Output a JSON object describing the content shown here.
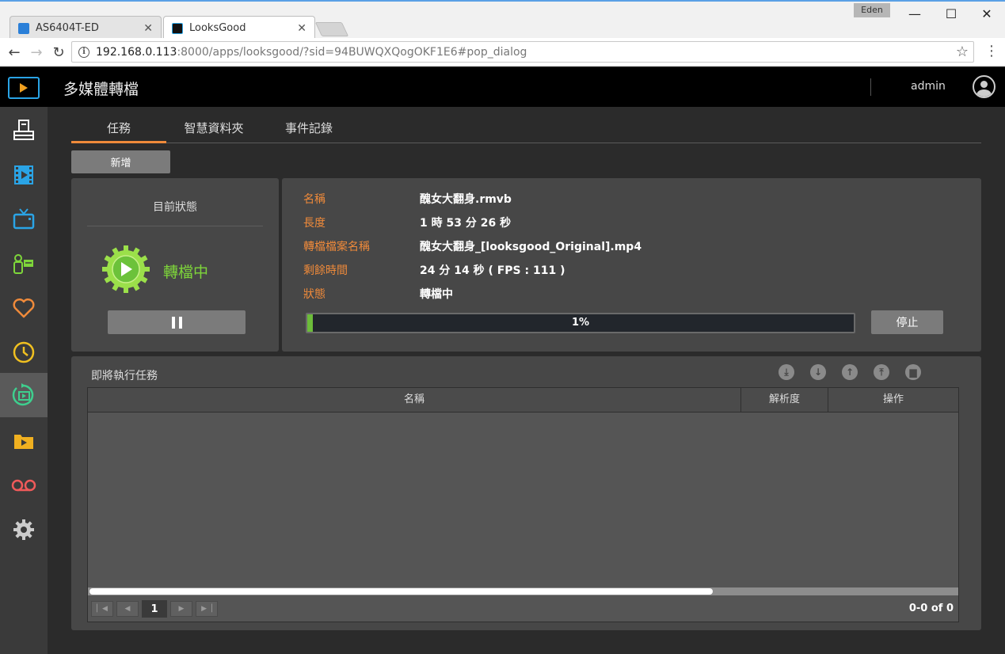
{
  "browser": {
    "tabs": [
      {
        "title": "AS6404T-ED",
        "active": false
      },
      {
        "title": "LooksGood",
        "active": true
      }
    ],
    "user_badge": "Eden",
    "url_host": "192.168.0.113",
    "url_rest": ":8000/apps/looksgood/?sid=94BUWQXQogOKF1E6#pop_dialog"
  },
  "header": {
    "title": "多媒體轉檔",
    "user": "admin"
  },
  "sidebar": {
    "items": [
      {
        "icon": "printer-icon",
        "color": "#ffffff"
      },
      {
        "icon": "film-icon",
        "color": "#2aa4e6"
      },
      {
        "icon": "tv-icon",
        "color": "#2aa4e6"
      },
      {
        "icon": "camcorder-icon",
        "color": "#7ed63a"
      },
      {
        "icon": "heart-icon",
        "color": "#ef8a3a"
      },
      {
        "icon": "clock-icon",
        "color": "#f0c020"
      },
      {
        "icon": "transcode-icon",
        "color": "#3ecf8e",
        "active": true
      },
      {
        "icon": "video-folder-icon",
        "color": "#f0b020"
      },
      {
        "icon": "voicemail-icon",
        "color": "#ef5a5a"
      },
      {
        "icon": "gear-icon",
        "color": "#cccccc"
      }
    ]
  },
  "tabs": [
    "任務",
    "智慧資料夾",
    "事件記錄"
  ],
  "add_label": "新增",
  "status": {
    "title": "目前狀態",
    "state": "轉檔中"
  },
  "detail": {
    "name_label": "名稱",
    "name_value": "醜女大翻身.rmvb",
    "length_label": "長度",
    "length_value": "1 時 53 分 26 秒",
    "output_label": "轉檔檔案名稱",
    "output_value": "醜女大翻身_[looksgood_Original].mp4",
    "remaining_label": "剩餘時間",
    "remaining_value": "24 分 14 秒 ( FPS : 111 )",
    "state_label": "狀態",
    "state_value": "轉檔中",
    "progress": 1,
    "progress_text": "1%",
    "stop_label": "停止"
  },
  "queue": {
    "title": "即將執行任務",
    "columns": [
      "名稱",
      "解析度",
      "操作"
    ],
    "page": "1",
    "count": "0-0 of 0"
  },
  "colors": {
    "accent": "#ef8a3a",
    "success": "#7ed63a"
  }
}
